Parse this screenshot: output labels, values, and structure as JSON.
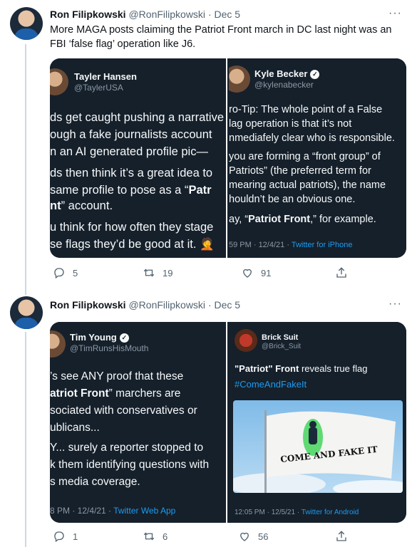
{
  "thread": [
    {
      "author_name": "Ron Filipkowski",
      "author_handle": "@RonFilipkowski",
      "separator": "·",
      "date": "Dec 5",
      "text": "More MAGA posts claiming the Patriot Front march in DC last night was an FBI ‘false flag’ operation like J6.",
      "more_icon": "···",
      "media": {
        "left": {
          "name": "Tayler Hansen",
          "handle": "@TaylerUSA",
          "lines": [
            "ds get caught pushing a narrative",
            "ough a fake journalists account",
            "n an AI generated profile pic—",
            "ds then think it’s a great idea to",
            "same profile to pose as a “",
            "nt",
            "” account.",
            "u think for how often they stage",
            "se flags they’d be good at it."
          ],
          "bold_a": "Patr",
          "emoji": "🤦"
        },
        "right": {
          "name": "Kyle Becker",
          "handle": "@kylenabecker",
          "lines": [
            "ro-Tip: The whole point of a False",
            "lag operation is that it’s not",
            "nmediafely clear who is responsible.",
            "you are forming a “front group” of",
            "Patriots” (the preferred term for",
            "mearing actual patriots), the name",
            "houldn’t be an obvious one.",
            "ay, “",
            "Patriot Front",
            ",” for example."
          ],
          "time": "59 PM · 12/4/21 · ",
          "source": "Twitter for iPhone"
        }
      },
      "replies": "5",
      "retweets": "19",
      "likes": "91"
    },
    {
      "author_name": "Ron Filipkowski",
      "author_handle": "@RonFilipkowski",
      "separator": "·",
      "date": "Dec 5",
      "more_icon": "···",
      "media": {
        "left": {
          "name": "Tim Young",
          "handle": "@TimRunsHisMouth",
          "lines": [
            "’s see ANY proof that these",
            "atriot Front",
            "” marchers are",
            "sociated with conservatives or",
            "ublicans...",
            "Y... surely a reporter stopped to",
            "k them identifying questions with",
            "s media coverage."
          ],
          "time": "8 PM · 12/4/21 · ",
          "source": "Twitter Web App"
        },
        "right": {
          "name": "Brick Suit",
          "handle": "@Brick_Suit",
          "line1_bold": "\"Patriot\" Front",
          "line1_rest": " reveals true flag",
          "hashtag": "#ComeAndFakeIt",
          "flag_text": "COME AND FAKE IT",
          "time": "12:05 PM · 12/5/21 · ",
          "source": "Twitter for Android"
        }
      },
      "replies": "1",
      "retweets": "6",
      "likes": "56"
    }
  ],
  "colors": {
    "media_bg": "#15202b",
    "link_blue": "#1d9bf0",
    "meta_gray": "#536471"
  }
}
